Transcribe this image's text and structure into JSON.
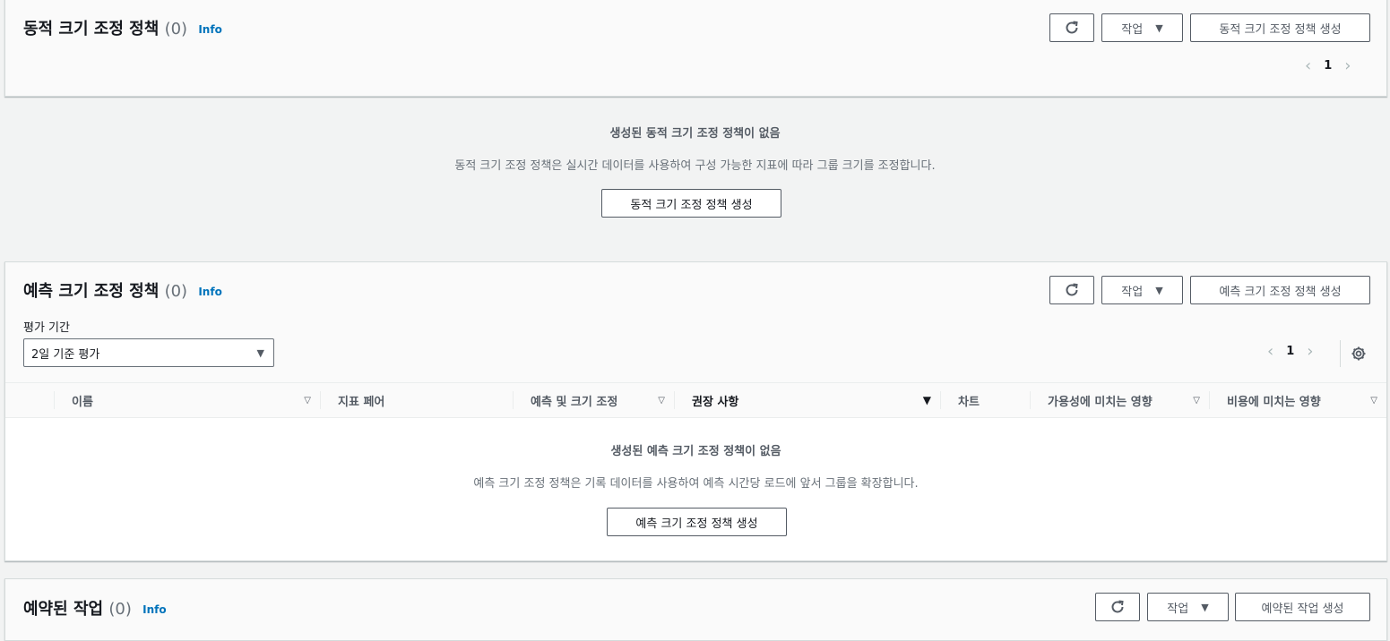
{
  "dynamic": {
    "title": "동적 크기 조정 정책",
    "count": "(0)",
    "info": "Info",
    "actions_label": "작업",
    "create_label": "동적 크기 조정 정책 생성",
    "page": "1",
    "empty_title": "생성된 동적 크기 조정 정책이 없음",
    "empty_desc": "동적 크기 조정 정책은 실시간 데이터를 사용하여 구성 가능한 지표에 따라 그룹 크기를 조정합니다.",
    "empty_button": "동적 크기 조정 정책 생성"
  },
  "predictive": {
    "title": "예측 크기 조정 정책",
    "count": "(0)",
    "info": "Info",
    "actions_label": "작업",
    "create_label": "예측 크기 조정 정책 생성",
    "eval_label": "평가 기간",
    "eval_value": "2일 기준 평가",
    "page": "1",
    "columns": [
      "이름",
      "지표 페어",
      "예측 및 크기 조정",
      "권장 사항",
      "차트",
      "가용성에 미치는 영향",
      "비용에 미치는 영향"
    ],
    "empty_title": "생성된 예측 크기 조정 정책이 없음",
    "empty_desc": "예측 크기 조정 정책은 기록 데이터를 사용하여 예측 시간당 로드에 앞서 그룹을 확장합니다.",
    "empty_button": "예측 크기 조정 정책 생성"
  },
  "scheduled": {
    "title": "예약된 작업",
    "count": "(0)",
    "info": "Info",
    "actions_label": "작업",
    "create_label": "예약된 작업 생성"
  },
  "icons": {
    "refresh": "refresh-icon",
    "caret": "caret-down-icon",
    "prev": "chevron-left-icon",
    "next": "chevron-right-icon",
    "settings": "gear-icon"
  }
}
